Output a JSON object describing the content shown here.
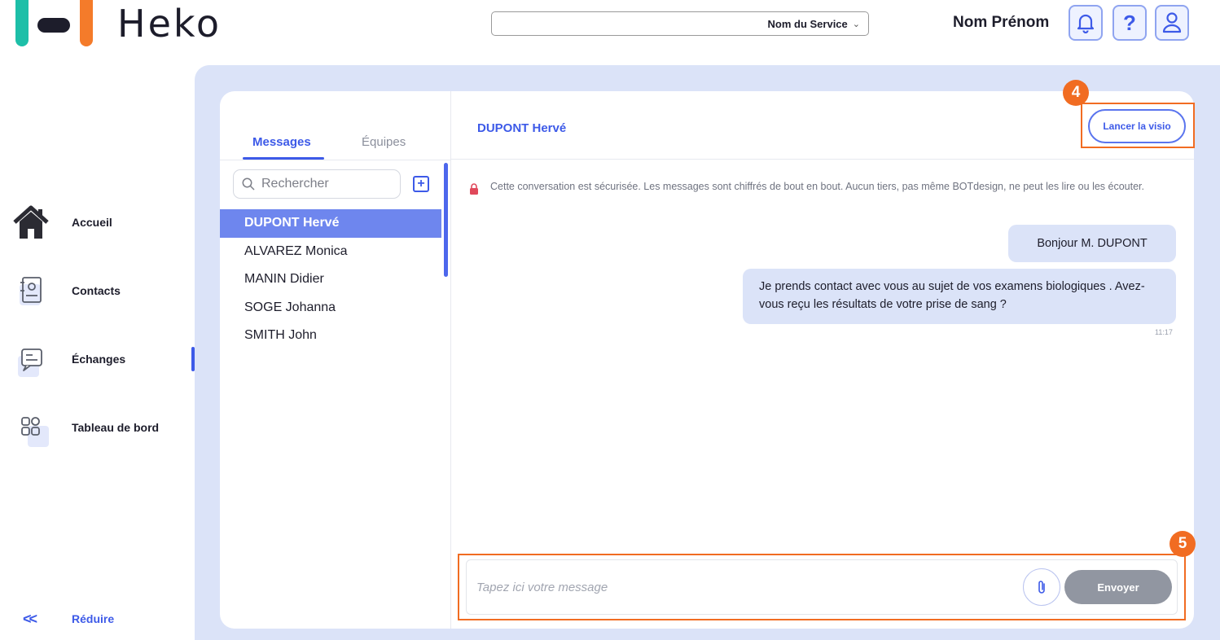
{
  "brand": {
    "name": "HeKO",
    "word": "Heko",
    "teal": "#1dbfa8",
    "orange": "#f47b2a",
    "dark": "#1d1d2b"
  },
  "header": {
    "service_select": "Nom du Service",
    "user_name": "Nom Prénom",
    "icons": [
      "bell-icon",
      "help-icon",
      "user-icon"
    ],
    "help_glyph": "?"
  },
  "sidebar": {
    "items": [
      {
        "label": "Accueil",
        "icon": "home-icon"
      },
      {
        "label": "Contacts",
        "icon": "contact-card-icon"
      },
      {
        "label": "Échanges",
        "icon": "chat-icon",
        "active": true
      },
      {
        "label": "Tableau de bord",
        "icon": "dashboard-icon"
      }
    ],
    "reduce_label": "Réduire",
    "reduce_glyph": "<<"
  },
  "list": {
    "tabs": [
      "Messages",
      "Équipes"
    ],
    "active_tab": "Messages",
    "search_placeholder": "Rechercher",
    "add_glyph": "+",
    "contacts": [
      "DUPONT Hervé",
      "ALVAREZ Monica",
      "MANIN Didier",
      "SOGE Johanna",
      "SMITH John"
    ],
    "selected_contact": "DUPONT Hervé"
  },
  "conversation": {
    "title": "DUPONT Hervé",
    "visio_button": "Lancer la visio",
    "security_notice": "Cette conversation est sécurisée. Les messages sont chiffrés de bout en bout. Aucun tiers, pas même BOTdesign, ne peut les lire ou les écouter.",
    "messages": [
      {
        "text": "Bonjour M. DUPONT"
      },
      {
        "text": "Je prends contact avec vous au sujet de vos examens biologiques . Avez-vous reçu les résultats de votre prise de sang ?"
      }
    ],
    "last_time": "11:17",
    "composer_placeholder": "Tapez ici votre message",
    "send_button": "Envoyer"
  },
  "annotations": {
    "badge_4": "4",
    "badge_5": "5",
    "color": "#f16c22"
  },
  "colors": {
    "accent": "#3d5ae8",
    "panel_bg": "#dbe3f8",
    "selected_row": "#6e86ee",
    "send_disabled": "#9196a1"
  }
}
